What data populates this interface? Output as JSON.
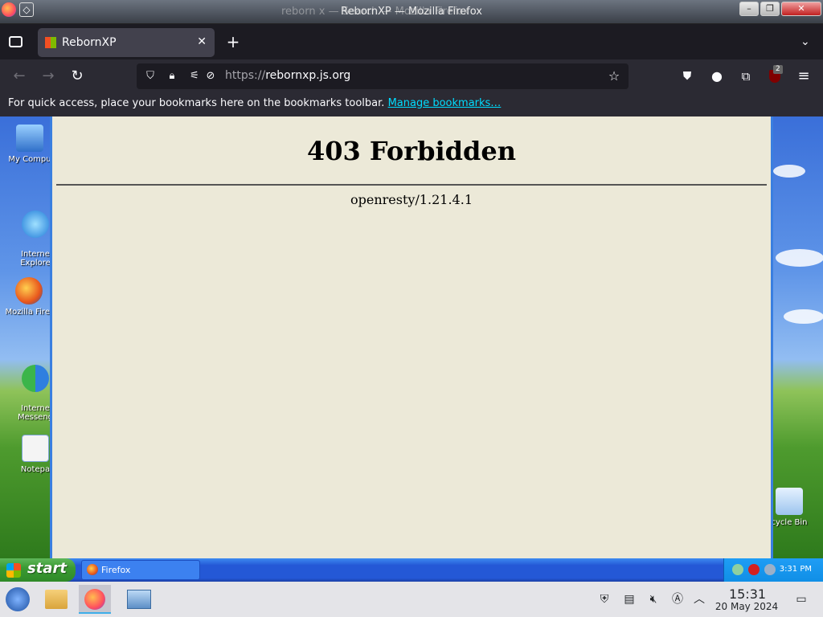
{
  "window": {
    "title": "RebornXP — Mozilla Firefox",
    "title_ghost": "reborn x — Search — Mozilla Firefox"
  },
  "tabs": [
    {
      "label": "RebornXP",
      "close": "✕"
    }
  ],
  "newtab_label": "+",
  "nav": {
    "back": "←",
    "forward": "→",
    "reload": "↻",
    "url_scheme": "https://",
    "url_host": "rebornxp.js.org",
    "extension_badge": "2"
  },
  "bookmarks": {
    "message": "For quick access, place your bookmarks here on the bookmarks toolbar.",
    "manage_link": "Manage bookmarks…"
  },
  "page": {
    "heading": "403 Forbidden",
    "server": "openresty/1.21.4.1"
  },
  "desktop_icons": [
    {
      "label": "My Compu"
    },
    {
      "label": "Interne\nExplore"
    },
    {
      "label": "Mozilla Firef"
    },
    {
      "label": "Interne\nMesseng"
    },
    {
      "label": "Notepa"
    },
    {
      "label": "cycle Bin"
    }
  ],
  "xp_taskbar": {
    "start_label": "start",
    "task_label": "Firefox",
    "clock": "3:31 PM"
  },
  "panel": {
    "time": "15:31",
    "date": "20 May 2024"
  },
  "colors": {
    "firefox_toolbar": "#2b2a33",
    "firefox_tabstrip": "#1c1b22",
    "accent_link": "#00ddff",
    "xp_window_bg": "#ece9d8",
    "xp_taskbar_blue": "#2458d6",
    "xp_start_green": "#3a9a33"
  }
}
